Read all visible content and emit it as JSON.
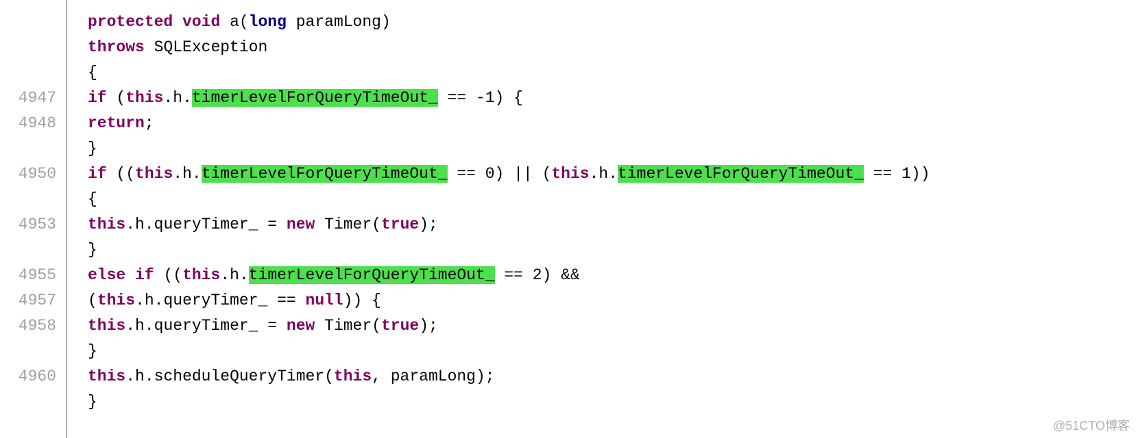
{
  "watermark": "@51CTO博客",
  "gutter": [
    "",
    "",
    "",
    "4947",
    "4948",
    "",
    "4950",
    "",
    "4953",
    "",
    "4955",
    "4957",
    "4958",
    "",
    "4960",
    ""
  ],
  "lines": [
    {
      "indent": 0,
      "spans": [
        {
          "cls": "kw",
          "t": "protected"
        },
        {
          "cls": "pl",
          "t": " "
        },
        {
          "cls": "kw",
          "t": "void"
        },
        {
          "cls": "pl",
          "t": " "
        },
        {
          "cls": "fn",
          "t": "a"
        },
        {
          "cls": "pl",
          "t": "("
        },
        {
          "cls": "bt",
          "t": "long"
        },
        {
          "cls": "pl",
          "t": " "
        },
        {
          "cls": "id",
          "t": "paramLong"
        },
        {
          "cls": "pl",
          "t": ")"
        }
      ]
    },
    {
      "indent": 1,
      "spans": [
        {
          "cls": "kw",
          "t": "throws"
        },
        {
          "cls": "pl",
          "t": " "
        },
        {
          "cls": "id",
          "t": "SQLException"
        }
      ]
    },
    {
      "indent": 0,
      "spans": [
        {
          "cls": "pl",
          "t": "{"
        }
      ]
    },
    {
      "indent": 1,
      "spans": [
        {
          "cls": "kw",
          "t": "if"
        },
        {
          "cls": "pl",
          "t": " ("
        },
        {
          "cls": "kw",
          "t": "this"
        },
        {
          "cls": "pl",
          "t": "."
        },
        {
          "cls": "id",
          "t": "h"
        },
        {
          "cls": "pl",
          "t": "."
        },
        {
          "cls": "hl",
          "t": "timerLevelForQueryTimeOut_"
        },
        {
          "cls": "pl",
          "t": " == -1) {"
        }
      ]
    },
    {
      "indent": 2,
      "spans": [
        {
          "cls": "kw",
          "t": "return"
        },
        {
          "cls": "pl",
          "t": ";"
        }
      ]
    },
    {
      "indent": 1,
      "spans": [
        {
          "cls": "pl",
          "t": "}"
        }
      ]
    },
    {
      "indent": 1,
      "spans": [
        {
          "cls": "kw",
          "t": "if"
        },
        {
          "cls": "pl",
          "t": " (("
        },
        {
          "cls": "kw",
          "t": "this"
        },
        {
          "cls": "pl",
          "t": "."
        },
        {
          "cls": "id",
          "t": "h"
        },
        {
          "cls": "pl",
          "t": "."
        },
        {
          "cls": "hl",
          "t": "timerLevelForQueryTimeOut_"
        },
        {
          "cls": "pl",
          "t": " == 0) || ("
        },
        {
          "cls": "kw",
          "t": "this"
        },
        {
          "cls": "pl",
          "t": "."
        },
        {
          "cls": "id",
          "t": "h"
        },
        {
          "cls": "pl",
          "t": "."
        },
        {
          "cls": "hl",
          "t": "timerLevelForQueryTimeOut_"
        },
        {
          "cls": "pl",
          "t": " == 1))"
        }
      ]
    },
    {
      "indent": 1,
      "spans": [
        {
          "cls": "pl",
          "t": "{"
        }
      ]
    },
    {
      "indent": 2,
      "spans": [
        {
          "cls": "kw",
          "t": "this"
        },
        {
          "cls": "pl",
          "t": "."
        },
        {
          "cls": "id",
          "t": "h"
        },
        {
          "cls": "pl",
          "t": "."
        },
        {
          "cls": "id",
          "t": "queryTimer_"
        },
        {
          "cls": "pl",
          "t": " = "
        },
        {
          "cls": "kw",
          "t": "new"
        },
        {
          "cls": "pl",
          "t": " "
        },
        {
          "cls": "id",
          "t": "Timer"
        },
        {
          "cls": "pl",
          "t": "("
        },
        {
          "cls": "kw",
          "t": "true"
        },
        {
          "cls": "pl",
          "t": ");"
        }
      ]
    },
    {
      "indent": 1,
      "spans": [
        {
          "cls": "pl",
          "t": "}"
        }
      ]
    },
    {
      "indent": 1,
      "spans": [
        {
          "cls": "kw",
          "t": "else"
        },
        {
          "cls": "pl",
          "t": " "
        },
        {
          "cls": "kw",
          "t": "if"
        },
        {
          "cls": "pl",
          "t": " (("
        },
        {
          "cls": "kw",
          "t": "this"
        },
        {
          "cls": "pl",
          "t": "."
        },
        {
          "cls": "id",
          "t": "h"
        },
        {
          "cls": "pl",
          "t": "."
        },
        {
          "cls": "hl",
          "t": "timerLevelForQueryTimeOut_"
        },
        {
          "cls": "pl",
          "t": " == 2) && "
        }
      ]
    },
    {
      "indent": 2,
      "spans": [
        {
          "cls": "pl",
          "t": "("
        },
        {
          "cls": "kw",
          "t": "this"
        },
        {
          "cls": "pl",
          "t": "."
        },
        {
          "cls": "id",
          "t": "h"
        },
        {
          "cls": "pl",
          "t": "."
        },
        {
          "cls": "id",
          "t": "queryTimer_"
        },
        {
          "cls": "pl",
          "t": " == "
        },
        {
          "cls": "kw",
          "t": "null"
        },
        {
          "cls": "pl",
          "t": ")) {"
        }
      ]
    },
    {
      "indent": 2,
      "spans": [
        {
          "cls": "kw",
          "t": "this"
        },
        {
          "cls": "pl",
          "t": "."
        },
        {
          "cls": "id",
          "t": "h"
        },
        {
          "cls": "pl",
          "t": "."
        },
        {
          "cls": "id",
          "t": "queryTimer_"
        },
        {
          "cls": "pl",
          "t": " = "
        },
        {
          "cls": "kw",
          "t": "new"
        },
        {
          "cls": "pl",
          "t": " "
        },
        {
          "cls": "id",
          "t": "Timer"
        },
        {
          "cls": "pl",
          "t": "("
        },
        {
          "cls": "kw",
          "t": "true"
        },
        {
          "cls": "pl",
          "t": ");"
        }
      ]
    },
    {
      "indent": 1,
      "spans": [
        {
          "cls": "pl",
          "t": "}"
        }
      ]
    },
    {
      "indent": 1,
      "spans": [
        {
          "cls": "kw",
          "t": "this"
        },
        {
          "cls": "pl",
          "t": "."
        },
        {
          "cls": "id",
          "t": "h"
        },
        {
          "cls": "pl",
          "t": "."
        },
        {
          "cls": "id",
          "t": "scheduleQueryTimer"
        },
        {
          "cls": "pl",
          "t": "("
        },
        {
          "cls": "kw",
          "t": "this"
        },
        {
          "cls": "pl",
          "t": ", "
        },
        {
          "cls": "id",
          "t": "paramLong"
        },
        {
          "cls": "pl",
          "t": ");"
        }
      ]
    },
    {
      "indent": 0,
      "spans": [
        {
          "cls": "pl",
          "t": "}"
        }
      ]
    }
  ]
}
